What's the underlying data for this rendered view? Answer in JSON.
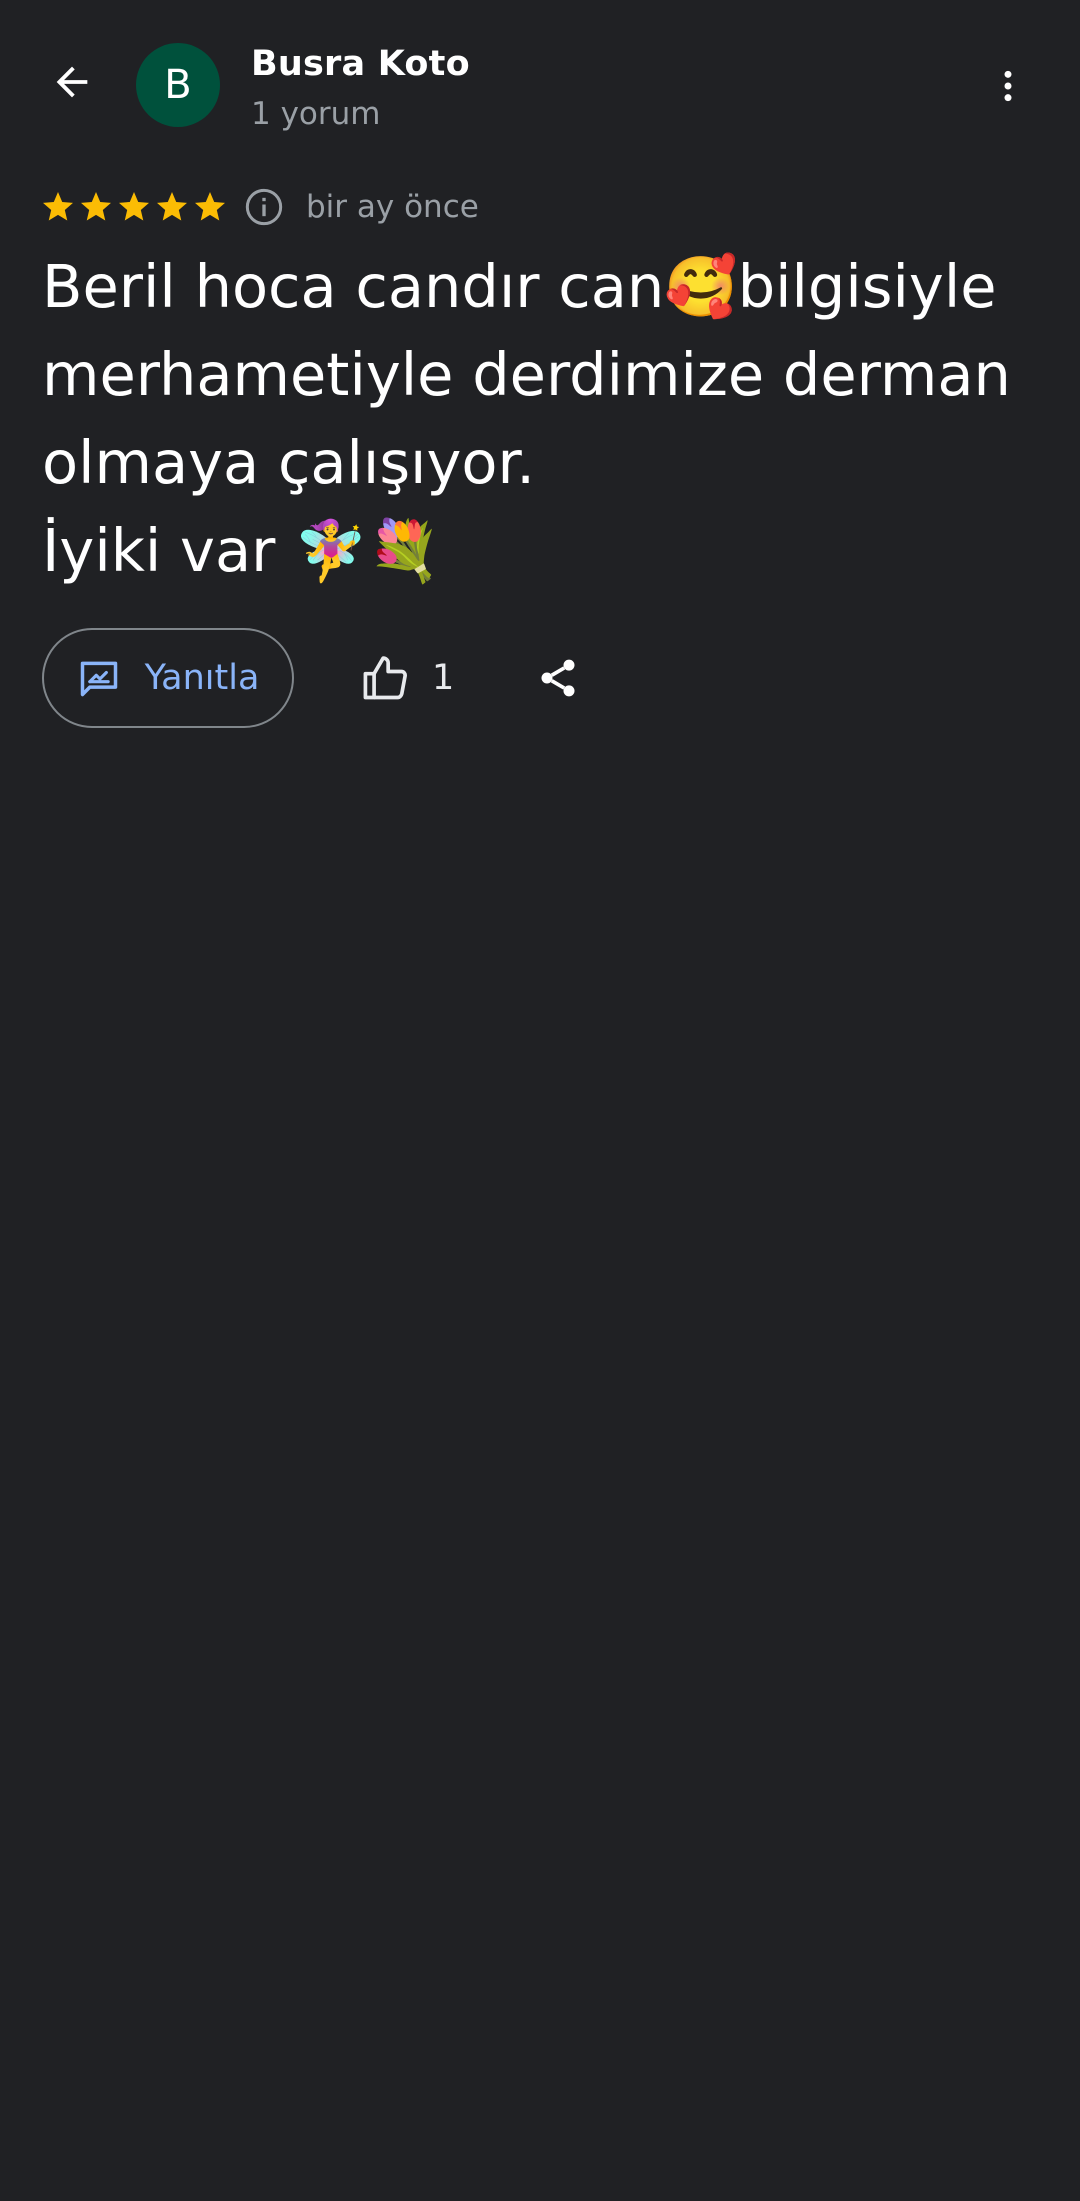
{
  "header": {
    "avatar_letter": "B",
    "avatar_color": "#00513c",
    "user_name": "Busra Koto",
    "review_count": "1 yorum",
    "back_icon": "arrow-back-icon",
    "more_icon": "more-vert-icon"
  },
  "review": {
    "rating": 5,
    "max_rating": 5,
    "star_color": "#fbbc04",
    "date": "bir ay önce",
    "text": "Beril hoca candır can🥰bilgisiyle\nmerhametiyle derdimize derman\nolmaya çalışıyor.\nİyiki var 🧚‍♀️💐"
  },
  "actions": {
    "reply_label": "Yanıtla",
    "reply_icon": "rate-review-icon",
    "like_count": "1",
    "like_icon": "thumb-up-icon",
    "share_icon": "share-icon",
    "accent_color": "#8ab4f8"
  }
}
